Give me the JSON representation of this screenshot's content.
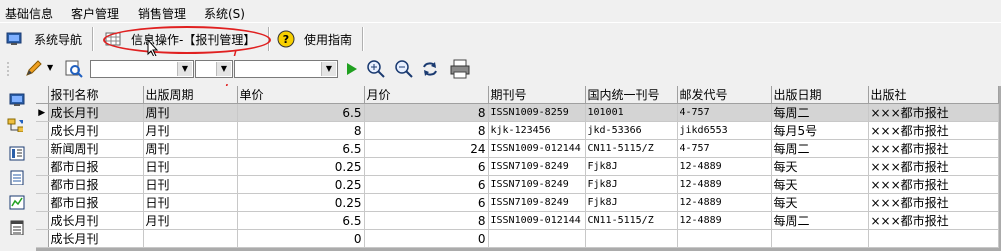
{
  "menu": [
    "基础信息",
    "客户管理",
    "销售管理",
    "系统(S)"
  ],
  "toolbar": {
    "nav_label": "系统导航",
    "op_label": "信息操作-【报刊管理】",
    "guide_label": "使用指南"
  },
  "combos": {
    "first_value": "",
    "second_value": "",
    "third_value": ""
  },
  "colors": {
    "highlight": "#e02020",
    "selected_row": "#d4d4d4"
  },
  "table": {
    "headers": [
      "报刊名称",
      "出版周期",
      "单价",
      "月价",
      "期刊号",
      "国内统一刊号",
      "邮发代号",
      "出版日期",
      "出版社"
    ],
    "rows": [
      [
        "成长月刊",
        "周刊",
        "6.5",
        "8",
        "ISSN1009-8259",
        "101001",
        "4-757",
        "每周二",
        "×××都市报社"
      ],
      [
        "成长月刊",
        "月刊",
        "8",
        "8",
        "kjk-123456",
        "jkd-53366",
        "jikd6553",
        "每月5号",
        "×××都市报社"
      ],
      [
        "新闻周刊",
        "周刊",
        "6.5",
        "24",
        "ISSN1009-012144",
        "CN11-5115/Z",
        "4-757",
        "每周二",
        "×××都市报社"
      ],
      [
        "都市日报",
        "日刊",
        "0.25",
        "6",
        "ISSN7109-8249",
        "Fjk8J",
        "12-4889",
        "每天",
        "×××都市报社"
      ],
      [
        "都市日报",
        "日刊",
        "0.25",
        "6",
        "ISSN7109-8249",
        "Fjk8J",
        "12-4889",
        "每天",
        "×××都市报社"
      ],
      [
        "都市日报",
        "日刊",
        "0.25",
        "6",
        "ISSN7109-8249",
        "Fjk8J",
        "12-4889",
        "每天",
        "×××都市报社"
      ],
      [
        "成长月刊",
        "月刊",
        "6.5",
        "8",
        "ISSN1009-012144",
        "CN11-5115/Z",
        "12-4889",
        "每周二",
        "×××都市报社"
      ],
      [
        "成长月刊",
        "",
        "0",
        "0",
        "",
        "",
        "",
        "",
        ""
      ]
    ]
  }
}
